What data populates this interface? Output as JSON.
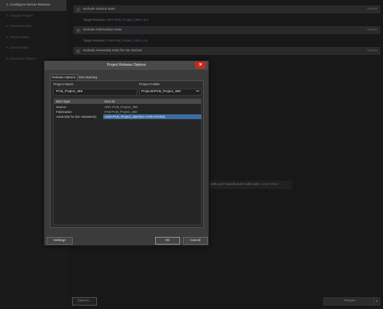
{
  "sidebar": {
    "steps": [
      {
        "label": "1. Configure Server Release",
        "active": true
      },
      {
        "label": "2. Validate Project"
      },
      {
        "label": "3. Generate Data"
      },
      {
        "label": "4. Review Data"
      },
      {
        "label": "5. Upload Data"
      },
      {
        "label": "6. Execution Report"
      }
    ]
  },
  "sections": [
    {
      "title": "Include Source Data",
      "details": "Details",
      "rev_label": "Target Revision:",
      "rev_value": "SRC-PCB_Project_359-A.2 ▾"
    },
    {
      "title": "Include Fabrication Data",
      "details": "Details",
      "rev_label": "Target Revision:",
      "rev_value": "FAB-PCB_Project_359-A.2 ▾"
    },
    {
      "title": "Include Assembly Data for No Variant",
      "details": "Details"
    }
  ],
  "notice": {
    "text": "with your manufacturer with ease.",
    "link": "Learn More"
  },
  "footer": {
    "options_label": "Options...",
    "prepare_label": "Prepare",
    "prepare_arrow": "▼"
  },
  "dialog": {
    "title": "Project Release Options",
    "close": "✕",
    "tabs": [
      {
        "label": "Release Options",
        "active": true
      },
      {
        "label": "Item Naming"
      }
    ],
    "project_name_label": "Project Name",
    "project_name_value": "PCB_Project_359",
    "project_folder_label": "Project Folder",
    "project_folder_value": "Projects\\PCB_Project_359",
    "folder_browse": "•••",
    "table": {
      "headers": [
        "Item Type",
        "Item ID"
      ],
      "rows": [
        [
          "Source",
          "SRC-PCB_Project_359"
        ],
        [
          "Fabrication",
          "FAB-PCB_Project_359"
        ],
        [
          "Assembly for [No Variations]",
          "ASM-PCB_Project_359-[NO VARIATIONS]"
        ]
      ],
      "selected_row": 2
    },
    "settings_label": "Settings",
    "ok_label": "OK",
    "cancel_label": "Cancel"
  }
}
